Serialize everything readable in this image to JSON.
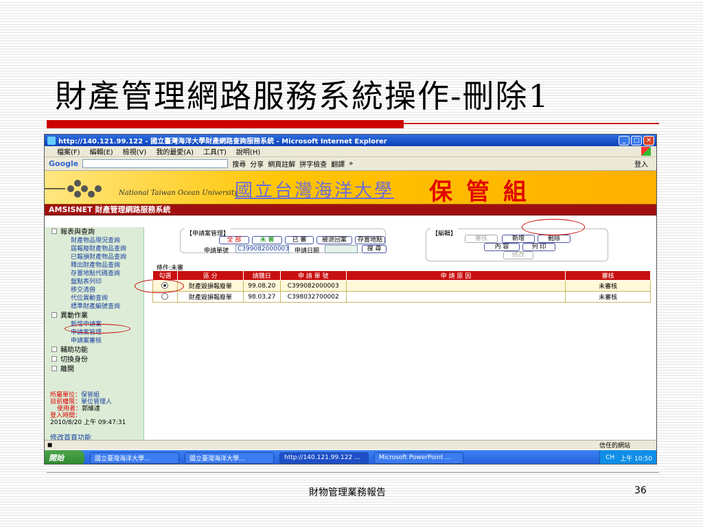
{
  "slide": {
    "title": "財產管理網路服務系統操作-刪除1",
    "footer": "財物管理業務報告",
    "page_number": "36"
  },
  "browser": {
    "window_title": "http://140.121.99.122 - 國立臺灣海洋大學財產網路查詢服務系統 - Microsoft Internet Explorer",
    "menu": [
      "檔案(F)",
      "編輯(E)",
      "檢視(V)",
      "我的最愛(A)",
      "工具(T)",
      "說明(H)"
    ],
    "toolbar": {
      "google": "Google",
      "search": "搜尋",
      "share": "分享",
      "annotate": "網頁註解",
      "spellcheck": "拼字檢查",
      "translate": "翻譯",
      "more": "»",
      "login": "登入"
    },
    "status": {
      "trusted": "信任的網站"
    }
  },
  "banner": {
    "university_en": "National Taiwan Ocean University",
    "university_zh": "國立台灣海洋大學",
    "dept": "保管組"
  },
  "system_bar": "AMSISNET 財產管理網路服務系統",
  "sidebar": {
    "groups": [
      {
        "label": "報表與查詢",
        "items": [
          "財產物品現況查詢",
          "屆報廢財產物品查詢",
          "已報損財產物品查詢",
          "釋出財產物品查詢",
          "存置地點代碼查詢",
          "盤點表列印",
          "移交清冊",
          "代位異動查詢",
          "標準財產編號查詢"
        ]
      },
      {
        "label": "異動作業",
        "items": [
          "新增申請案",
          "申請案管理",
          "申請案審核"
        ]
      },
      {
        "label": "輔助功能",
        "items": []
      },
      {
        "label": "切換身份",
        "items": []
      },
      {
        "label": "離開",
        "items": []
      }
    ],
    "info": {
      "unit_key": "所屬單位：",
      "unit_val": "保管組",
      "perm_key": "目前權限：",
      "perm_val": "單位管理人",
      "user_key": "使用者：",
      "user_val": "郭維達",
      "login_key": "登入時間：",
      "login_val": "2010/8/20 上午 09:47:31"
    },
    "home_link": "修改首頁功能"
  },
  "apply_panel": {
    "label": "【申請案管理】",
    "buttons": [
      "全 部",
      "未 審",
      "已 審",
      "被退回案",
      "存置地點"
    ],
    "case_no_label": "申請單號",
    "case_no_value": "C399082000003",
    "date_label": "申請日期",
    "date_value": "",
    "search_button": "搜 尋"
  },
  "edit_panel": {
    "label": "【編輯】",
    "review": "審核",
    "add": "新增",
    "delete": "刪除",
    "content": "內 容",
    "print": "列 印",
    "modify": "修改"
  },
  "grid": {
    "condition": "條件:未審",
    "headers": [
      "勾選",
      "區 分",
      "請購日",
      "申 請 單 號",
      "申 請 原 因",
      "審核"
    ],
    "rows": [
      {
        "selected": true,
        "type": "財產毀損報廢單",
        "date": "99.08.20",
        "case_no": "C399082000003",
        "reason": "",
        "status": "未審核"
      },
      {
        "selected": false,
        "type": "財產毀損報廢單",
        "date": "98.03.27",
        "case_no": "C398032700002",
        "reason": "",
        "status": "未審核"
      }
    ]
  },
  "taskbar": {
    "start": "開始",
    "tasks": [
      "國立臺灣海洋大學...",
      "國立臺灣海洋大學...",
      "http://140.121.99.122 ...",
      "Microsoft PowerPoint ..."
    ],
    "lang": "CH",
    "clock": "上午 10:50"
  },
  "colors": {
    "accent_red": "#cc0000",
    "banner_yellow": "#ffc400",
    "sidebar_green": "#dcecd6",
    "grid_header": "#c81010"
  }
}
